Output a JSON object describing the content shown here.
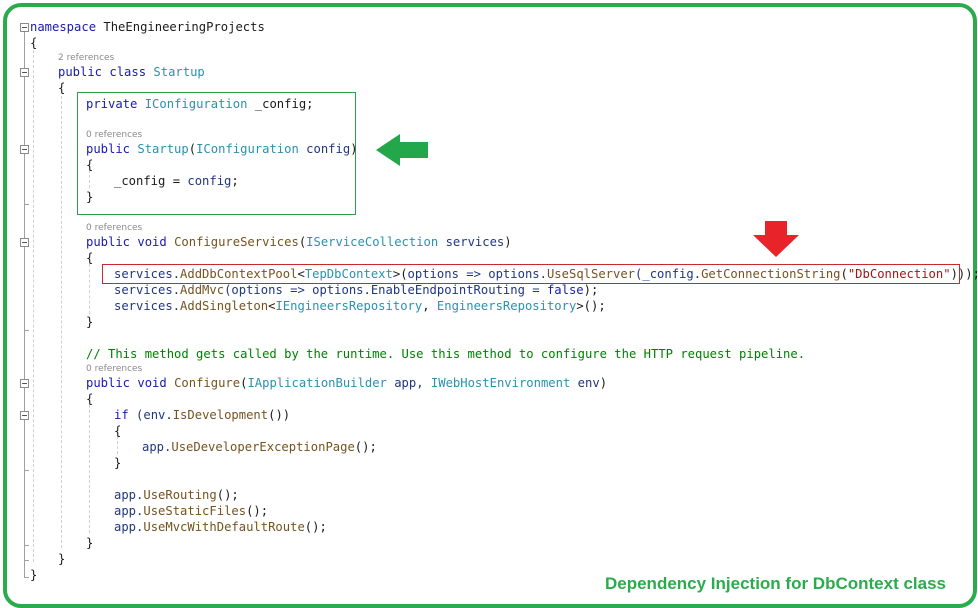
{
  "editor": {
    "references": {
      "class_refs": "2 references",
      "ctor_refs": "0 references",
      "configure_services_refs": "0 references",
      "configure_refs": "0 references"
    },
    "lines": {
      "l1_kw": "namespace",
      "l1_name": " TheEngineeringProjects",
      "open": "{",
      "close": "}",
      "l3_kw": "public class",
      "l3_name": "Startup",
      "l5_kw": "private",
      "l5_type": "IConfiguration",
      "l5_rest": " _config;",
      "l7_kw": "public",
      "l7_fn": "Startup",
      "l7_p1": "(",
      "l7_type": "IConfiguration",
      "l7_id": " config",
      "l7_p2": ")",
      "l9_a": "_config = ",
      "l9_b": "config",
      "l9_c": ";",
      "l12_kw": "public void",
      "l12_fn": "ConfigureServices",
      "l12_p1": "(",
      "l12_type": "IServiceCollection",
      "l12_id": " services",
      "l12_p2": ")",
      "l14_a": "services.",
      "l14_fn": "AddDbContextPool",
      "l14_lt": "<",
      "l14_type": "TepDbContext",
      "l14_gt": ">(",
      "l14_b": "options => options.",
      "l14_fn2": "UseSqlServer",
      "l14_c": "(_config.",
      "l14_fn3": "GetConnectionString",
      "l14_d": "(",
      "l14_str": "\"DbConnection\"",
      "l14_e": ")));",
      "l15_a": "services.",
      "l15_fn": "AddMvc",
      "l15_b": "(options => options.EnableEndpointRouting = ",
      "l15_kw": "false",
      "l15_c": ");",
      "l16_a": "services.",
      "l16_fn": "AddSingleton",
      "l16_lt": "<",
      "l16_t1": "IEngineersRepository",
      "l16_comma": ", ",
      "l16_t2": "EngineersRepository",
      "l16_c": ">();",
      "l19_comment": "// This method gets called by the runtime. Use this method to configure the HTTP request pipeline.",
      "l20_kw": "public void",
      "l20_fn": "Configure",
      "l20_p1": "(",
      "l20_t1": "IApplicationBuilder",
      "l20_id1": " app, ",
      "l20_t2": "IWebHostEnvironment",
      "l20_id2": " env",
      "l20_p2": ")",
      "l22_kw": "if",
      "l22_a": " (env.",
      "l22_fn": "IsDevelopment",
      "l22_b": "())",
      "l24_a": "app.",
      "l24_fn": "UseDeveloperExceptionPage",
      "l24_b": "();",
      "l27_a": "app.",
      "l27_fn": "UseRouting",
      "l27_b": "();",
      "l28_a": "app.",
      "l28_fn": "UseStaticFiles",
      "l28_b": "();",
      "l29_a": "app.",
      "l29_fn": "UseMvcWithDefaultRoute",
      "l29_b": "();"
    }
  },
  "annotations": {
    "caption": "Dependency Injection for DbContext class",
    "green_arrow_color": "#22a84a",
    "red_arrow_color": "#e8232a"
  }
}
